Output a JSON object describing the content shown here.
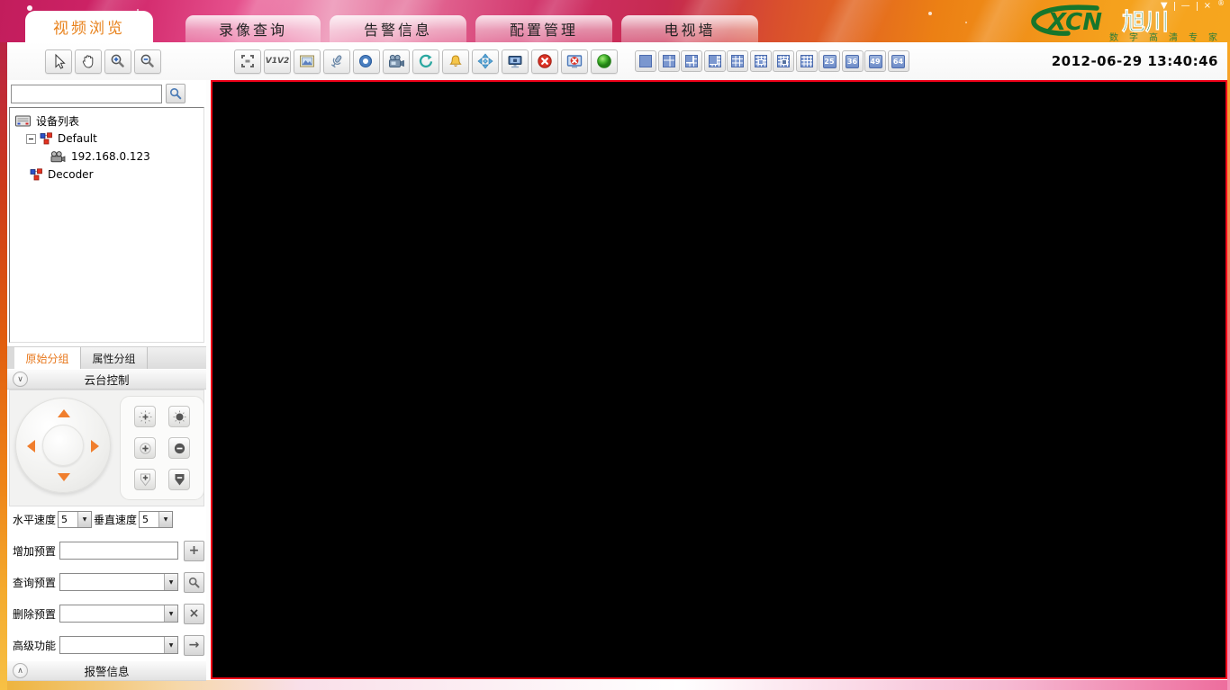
{
  "window": {
    "brand": "XCN",
    "brand_cn": "旭川",
    "tagline": "数字高清专家",
    "controls": {
      "rollup": "▼",
      "minimize": "—",
      "close": "×",
      "registered": "®"
    }
  },
  "nav_tabs": [
    {
      "label": "视频浏览",
      "active": true
    },
    {
      "label": "录像查询",
      "active": false
    },
    {
      "label": "告警信息",
      "active": false
    },
    {
      "label": "配置管理",
      "active": false
    },
    {
      "label": "电视墙",
      "active": false
    }
  ],
  "toolbar": {
    "datetime": "2012-06-29 13:40:46",
    "v1v2_label": "V1V2",
    "icons": [
      "cursor",
      "pan-hand",
      "zoom-in",
      "zoom-out",
      "fullscreen",
      "v1v2-stream",
      "snapshot",
      "microphone",
      "speaker",
      "camcorder",
      "refresh",
      "alarm-bell",
      "ptz-move",
      "screen-capture",
      "stop",
      "stop-all",
      "start-monitor"
    ],
    "layout_grid_icons": [
      "1-split",
      "4-split",
      "6-split",
      "8-split",
      "9-split",
      "13-split",
      "16-split-center",
      "16-split"
    ],
    "layout_numbers": [
      "25",
      "36",
      "49",
      "64"
    ]
  },
  "sidebar": {
    "search": {
      "value": ""
    },
    "device_tree": {
      "items": [
        {
          "label": "设备列表",
          "level": 0,
          "icon": "device-list"
        },
        {
          "label": "Default",
          "level": 1,
          "icon": "group",
          "expanded": true
        },
        {
          "label": "192.168.0.123",
          "level": 2,
          "icon": "camera"
        },
        {
          "label": "Decoder",
          "level": 1,
          "icon": "group"
        }
      ]
    },
    "group_tabs": [
      {
        "label": "原始分组",
        "active": true
      },
      {
        "label": "属性分组",
        "active": false
      }
    ],
    "ptz": {
      "title": "云台控制",
      "horizontal_speed": {
        "label": "水平速度",
        "value": "5"
      },
      "vertical_speed": {
        "label": "垂直速度",
        "value": "5"
      },
      "preset_add": {
        "label": "增加预置",
        "value": ""
      },
      "preset_query": {
        "label": "查询预置",
        "value": ""
      },
      "preset_delete": {
        "label": "删除预置",
        "value": ""
      },
      "advanced": {
        "label": "高级功能",
        "value": ""
      }
    },
    "alarm": {
      "title": "报警信息"
    }
  },
  "glyphs": {
    "dropdown_arrow": "▼",
    "chevron_down": "∨",
    "chevron_up": "∧",
    "plus": "+",
    "delete_x": "×",
    "arrow_right": "→"
  },
  "colors": {
    "accent_orange": "#e8791e",
    "video_border_red": "#f00018",
    "logo_green": "#17762c",
    "layout_icon_blue": "#7b97cf",
    "header_magenta": "#c21d5c",
    "header_orange": "#f5a11d"
  }
}
